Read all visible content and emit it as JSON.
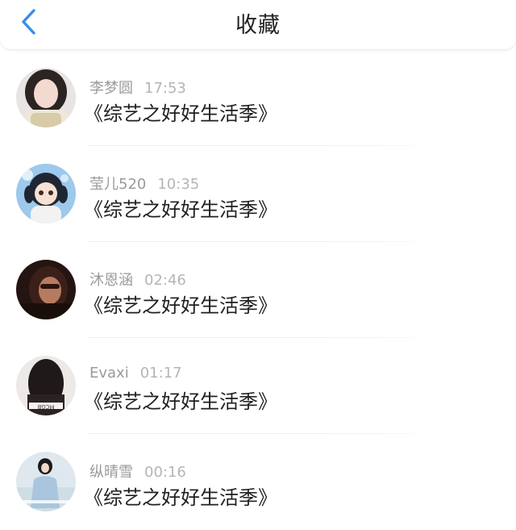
{
  "header": {
    "title": "收藏",
    "back_icon": "chevron-left-icon",
    "accent_color": "#3a8ee6"
  },
  "favorites": [
    {
      "name": "李梦圆",
      "time": "17:53",
      "message": "《综艺之好好生活季》"
    },
    {
      "name": "莹儿520",
      "time": "10:35",
      "message": "《综艺之好好生活季》"
    },
    {
      "name": "沐恩涵",
      "time": "02:46",
      "message": "《综艺之好好生活季》"
    },
    {
      "name": "Evaxi",
      "time": "01:17",
      "message": "《综艺之好好生活季》"
    },
    {
      "name": "纵晴雪",
      "time": "00:16",
      "message": "《综艺之好好生活季》"
    }
  ]
}
